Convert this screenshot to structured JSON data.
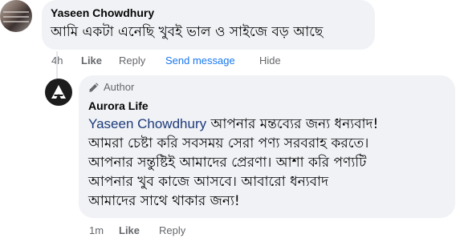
{
  "comment": {
    "author": "Yaseen Chowdhury",
    "text": "আমি একটা এনেছি খুবই ভাল ও সাইজে বড় আছে",
    "time": "4h",
    "like_label": "Like",
    "reply_label": "Reply",
    "send_message_label": "Send message",
    "hide_label": "Hide"
  },
  "reply": {
    "badge_label": "Author",
    "author": "Aurora Life",
    "mention": "Yaseen Chowdhury",
    "line1_rest": "আপনার মন্তব্যের জন্য ধন্যবাদ!",
    "line2": "আমরা চেষ্টা করি সবসময় সেরা পণ্য সরবরাহ করতে।",
    "line3": "আপনার সন্তুষ্টিই আমাদের প্রেরণা। আশা করি পণ্যটি",
    "line4": "আপনার খুব কাজে আসবে। আবারো ধন্যবাদ",
    "line5": "আমাদের সাথে থাকার জন্য!",
    "time": "1m",
    "like_label": "Like",
    "reply_label": "Reply"
  },
  "icons": {
    "author_badge": "pencil-icon",
    "page_logo": "aurora-logo-icon"
  }
}
